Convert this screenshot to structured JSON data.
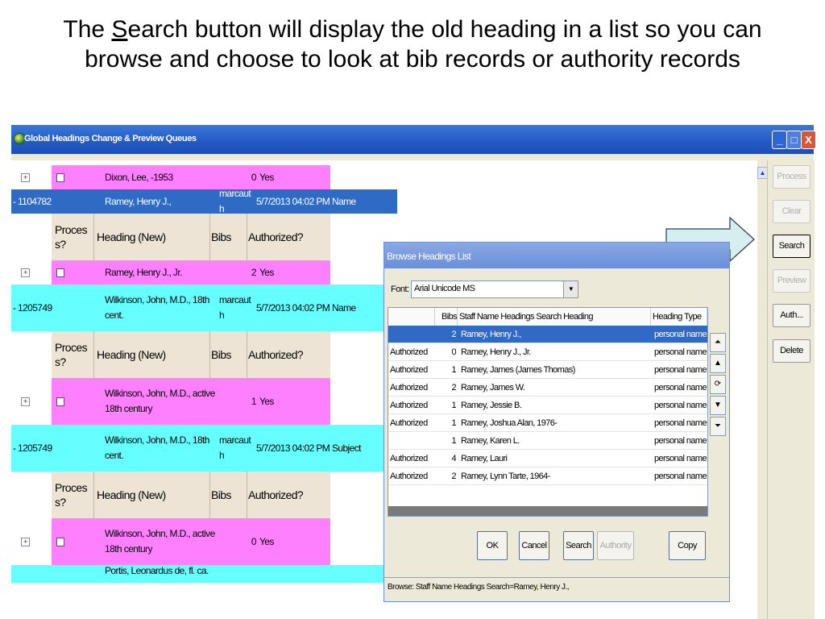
{
  "slide": {
    "title_pre": "The ",
    "title_u": "S",
    "title_post": "earch button will display the old heading in a list so you can browse and choose to look at bib records or authority records"
  },
  "window": {
    "title": "Global Headings Change & Preview Queues",
    "btn_min": "_",
    "btn_max": "□",
    "btn_close": "X"
  },
  "grid": {
    "rows": [
      {
        "kind": "child",
        "expander": "+",
        "heading": "Dixon, Lee, -1953",
        "bibs": "0",
        "auth": "Yes"
      },
      {
        "kind": "parent",
        "expander": "-",
        "id": "1104782",
        "heading": "Ramey, Henry J.,",
        "user": "marcauth",
        "date": "5/7/2013 04:02 PM",
        "type": "Name"
      },
      {
        "kind": "header",
        "c1": "Process?",
        "c2": "Heading (New)",
        "c3": "Bibs",
        "c4": "Authorized?"
      },
      {
        "kind": "child",
        "expander": "+",
        "heading": "Ramey, Henry J., Jr.",
        "bibs": "2",
        "auth": "Yes"
      },
      {
        "kind": "parent",
        "expander": "-",
        "id": "1205749",
        "heading": "Wilkinson, John, M.D., 18th cent.",
        "user": "marcauth",
        "date": "5/7/2013 04:02 PM",
        "type": "Name"
      },
      {
        "kind": "header",
        "c1": "Process?",
        "c2": "Heading (New)",
        "c3": "Bibs",
        "c4": "Authorized?"
      },
      {
        "kind": "child",
        "expander": "+",
        "heading": "Wilkinson, John, M.D., active 18th century",
        "bibs": "1",
        "auth": "Yes"
      },
      {
        "kind": "parent",
        "expander": "-",
        "id": "1205749",
        "heading": "Wilkinson, John, M.D., 18th cent.",
        "user": "marcauth",
        "date": "5/7/2013 04:02 PM",
        "type": "Subject"
      },
      {
        "kind": "header",
        "c1": "Process?",
        "c2": "Heading (New)",
        "c3": "Bibs",
        "c4": "Authorized?"
      },
      {
        "kind": "child",
        "expander": "+",
        "heading": "Wilkinson, John, M.D., active 18th century",
        "bibs": "0",
        "auth": "Yes"
      },
      {
        "kind": "partial",
        "heading": "Portis, Leonardus de, fl. ca."
      }
    ]
  },
  "side_buttons": [
    {
      "label": "Process",
      "disabled": true
    },
    {
      "label": "Clear",
      "disabled": true
    },
    {
      "label": "Search",
      "disabled": false
    },
    {
      "label": "Preview",
      "disabled": true
    },
    {
      "label": "Auth...",
      "disabled": false
    },
    {
      "label": "Delete",
      "disabled": false
    }
  ],
  "dialog": {
    "title": "Browse Headings List",
    "font_label": "Font:",
    "font_value": "Arial Unicode MS",
    "columns": [
      "",
      "Bibs",
      "Staff Name Headings Search Heading",
      "Heading Type"
    ],
    "rows": [
      {
        "status": "",
        "bibs": "2",
        "heading": "Ramey, Henry J.,",
        "type": "personal name",
        "selected": true
      },
      {
        "status": "Authorized",
        "bibs": "0",
        "heading": "Ramey, Henry J., Jr.",
        "type": "personal name"
      },
      {
        "status": "Authorized",
        "bibs": "1",
        "heading": "Ramey, James (James Thomas)",
        "type": "personal name"
      },
      {
        "status": "Authorized",
        "bibs": "2",
        "heading": "Ramey, James W.",
        "type": "personal name"
      },
      {
        "status": "Authorized",
        "bibs": "1",
        "heading": "Ramey, Jessie B.",
        "type": "personal name"
      },
      {
        "status": "Authorized",
        "bibs": "1",
        "heading": "Ramey, Joshua Alan, 1976-",
        "type": "personal name"
      },
      {
        "status": "",
        "bibs": "1",
        "heading": "Ramey, Karen L.",
        "type": "personal name"
      },
      {
        "status": "Authorized",
        "bibs": "4",
        "heading": "Ramey, Lauri",
        "type": "personal name"
      },
      {
        "status": "Authorized",
        "bibs": "2",
        "heading": "Ramey, Lynn Tarte, 1964-",
        "type": "personal name"
      }
    ],
    "nav": [
      "⏶",
      "▲",
      "⟳",
      "▼",
      "⏷"
    ],
    "buttons": {
      "ok": "OK",
      "cancel": "Cancel",
      "search": "Search",
      "authority": "Authority",
      "copy": "Copy"
    },
    "status": "Browse: Staff Name Headings Search=Ramey, Henry J.,"
  }
}
